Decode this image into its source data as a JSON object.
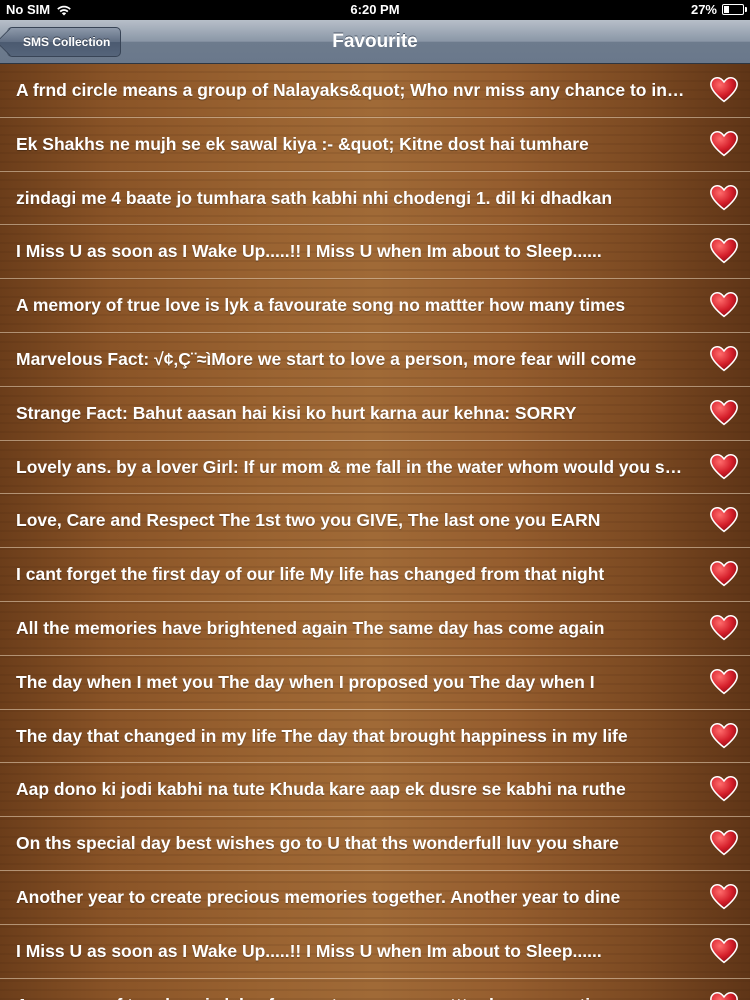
{
  "status_bar": {
    "carrier": "No SIM",
    "time": "6:20 PM",
    "battery": "27%",
    "icons": [
      "wifi-icon",
      "battery-icon"
    ]
  },
  "nav": {
    "title": "Favourite",
    "back_label": "SMS Collection"
  },
  "colors": {
    "nav_bar": "#7d8a9b",
    "heart": "#d41e2a",
    "row_divider": "#ead7be",
    "wood": "#955d2e"
  },
  "favourites": [
    "A frnd circle means a group of Nalayaks&quot; Who nvr miss any chance to insult you",
    "Ek Shakhs ne mujh se ek sawal kiya :-  &quot; Kitne dost hai tumhare",
    "zindagi me 4 baate jo tumhara sath kabhi nhi chodengi 1. dil ki dhadkan",
    "I Miss U as soon as I Wake Up.....!!   I Miss U when Im about to Sleep......",
    "A memory of true love is lyk a favourate song no mattter how many times",
    "Marvelous Fact: √¢‚Ç¨≈ìMore we start to love a person, more fear will come",
    "Strange Fact: Bahut aasan hai kisi ko hurt karna aur kehna: SORRY",
    "Lovely ans. by a lover  Girl: If ur mom & me fall in the water whom would you save",
    "Love, Care and Respect The 1st two you GIVE, The last one you EARN",
    "I cant forget the first day of our life My life has changed from that night",
    "All the memories have brightened again The same day has come again",
    "The day when I met you The day when I proposed you The day when I",
    "The day that changed in my life The day that brought happiness in my life",
    "Aap dono ki jodi kabhi na tute Khuda kare aap ek dusre se kabhi na ruthe",
    "On ths special day best wishes go to U that ths wonderfull luv you share",
    "Another year to create precious memories together. Another year to dine",
    "I Miss U as soon as I Wake Up.....!!   I Miss U when Im about to Sleep......",
    "A memory of true love is lyk a favourate song no mattter how many times"
  ]
}
